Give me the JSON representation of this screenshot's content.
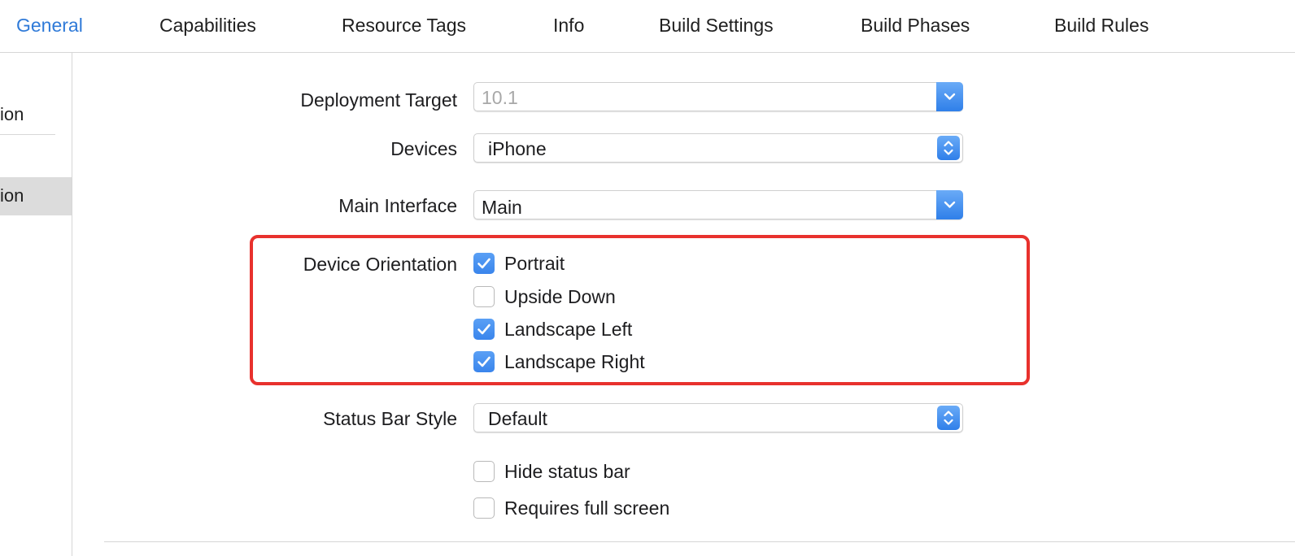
{
  "tabs": {
    "general": "General",
    "capabilities": "Capabilities",
    "resource_tags": "Resource Tags",
    "info": "Info",
    "build_settings": "Build Settings",
    "build_phases": "Build Phases",
    "build_rules": "Build Rules"
  },
  "sidebar": {
    "item1": "ion",
    "item2": "ion"
  },
  "deployment_info": {
    "deployment_target": {
      "label": "Deployment Target",
      "value": "10.1",
      "icon": "chevron-down-icon"
    },
    "devices": {
      "label": "Devices",
      "value": "iPhone",
      "icon": "up-down-chevron-icon"
    },
    "main_interface": {
      "label": "Main Interface",
      "value": "Main",
      "icon": "chevron-down-icon"
    },
    "device_orientation": {
      "label": "Device Orientation",
      "options": [
        {
          "label": "Portrait",
          "checked": true
        },
        {
          "label": "Upside Down",
          "checked": false
        },
        {
          "label": "Landscape Left",
          "checked": true
        },
        {
          "label": "Landscape Right",
          "checked": true
        }
      ]
    },
    "status_bar_style": {
      "label": "Status Bar Style",
      "value": "Default",
      "icon": "up-down-chevron-icon"
    },
    "hide_status_bar": {
      "label": "Hide status bar",
      "checked": false
    },
    "requires_full_screen": {
      "label": "Requires full screen",
      "checked": false
    }
  },
  "colors": {
    "accent": "#2f7ad8",
    "highlight": "#e8312d"
  }
}
